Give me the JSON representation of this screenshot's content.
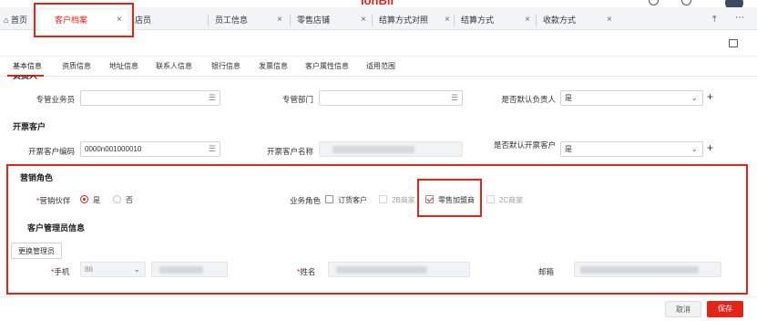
{
  "app": {
    "logo_text": "IonBir"
  },
  "tabs": [
    {
      "label": "首页",
      "closable": false
    },
    {
      "label": "客户档案",
      "closable": true,
      "active": true
    },
    {
      "label": "店员",
      "closable": false
    },
    {
      "label": "员工信息",
      "closable": true
    },
    {
      "label": "零售店铺",
      "closable": true
    },
    {
      "label": "结算方式对照",
      "closable": true
    },
    {
      "label": "结算方式",
      "closable": true
    },
    {
      "label": "收款方式",
      "closable": true
    }
  ],
  "sub_tabs": [
    "基本信息",
    "资质信息",
    "地址信息",
    "联系人信息",
    "银行信息",
    "发票信息",
    "客户属性信息",
    "适用范围"
  ],
  "form": {
    "principal_section_title": "负责人",
    "salesman_label": "专管业务员",
    "department_label": "专管部门",
    "default_principal_label": "是否默认负责人",
    "default_principal_value": "是",
    "invoice_section_title": "开票客户",
    "invoice_code_label": "开票客户编码",
    "invoice_code_value": "0000n001000010",
    "invoice_name_label": "开票客户名称",
    "default_invoice_label": "是否默认开票客户",
    "default_invoice_value": "是",
    "marketing_section_title": "营销角色",
    "partner_required_mark": "*",
    "partner_label": "营销伙伴",
    "partner_yes": "是",
    "partner_no": "否",
    "partner_value": "是",
    "business_role_label": "业务角色",
    "roles": [
      {
        "label": "订货客户",
        "checked": false,
        "enabled": true
      },
      {
        "label": "2B商家",
        "checked": false,
        "enabled": false
      },
      {
        "label": "零售加盟商",
        "checked": true,
        "enabled": true
      },
      {
        "label": "2C商家",
        "checked": false,
        "enabled": false
      }
    ],
    "admin_section_title": "客户管理员信息",
    "change_admin_button": "更换管理员",
    "phone_required_mark": "*",
    "phone_label": "手机",
    "phone_prefix": "86",
    "name_required_mark": "*",
    "name_label": "姓名",
    "email_label": "邮箱"
  },
  "footer": {
    "cancel": "取消",
    "save": "保存"
  },
  "colors": {
    "accent": "#e1251b",
    "annotation_box": "#e1251b"
  }
}
